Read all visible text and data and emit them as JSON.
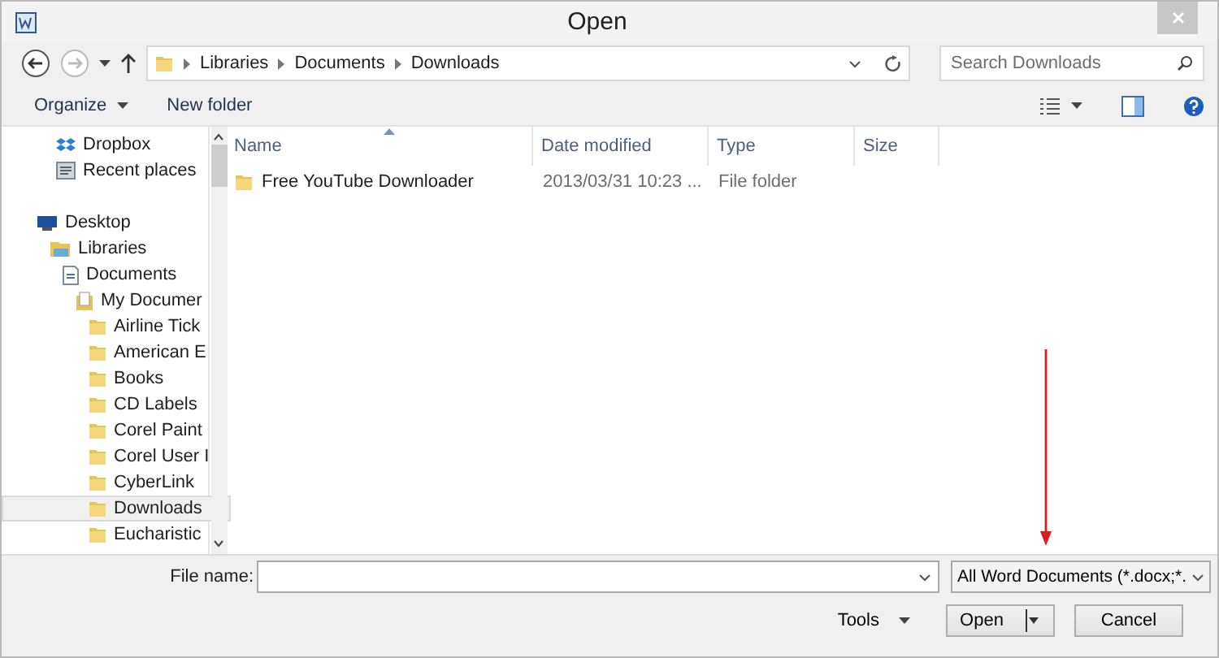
{
  "window": {
    "title": "Open"
  },
  "address_bar": {
    "path": [
      "Libraries",
      "Documents",
      "Downloads"
    ]
  },
  "search": {
    "placeholder": "Search Downloads"
  },
  "toolbar": {
    "buttons": [
      {
        "label": "Organize",
        "dropdown": true
      },
      {
        "label": "New folder",
        "dropdown": false
      }
    ]
  },
  "sidebar": {
    "favorites": [
      {
        "label": "Dropbox",
        "kind": "dropbox",
        "selected": false
      },
      {
        "label": "Recent places",
        "kind": "recent",
        "selected": false
      }
    ],
    "tree": [
      {
        "label": "Desktop",
        "kind": "desktop",
        "selected": false,
        "children": [
          {
            "label": "Libraries",
            "kind": "libraries",
            "selected": false,
            "children": [
              {
                "label": "Documents",
                "kind": "document",
                "selected": false,
                "children": [
                  {
                    "label": "My Documer",
                    "kind": "folder-doc",
                    "selected": false,
                    "children": [
                      {
                        "label": "Airline Tick",
                        "kind": "folder",
                        "selected": false
                      },
                      {
                        "label": "American E",
                        "kind": "folder",
                        "selected": false
                      },
                      {
                        "label": "Books",
                        "kind": "folder",
                        "selected": false
                      },
                      {
                        "label": "CD Labels",
                        "kind": "folder",
                        "selected": false
                      },
                      {
                        "label": "Corel Paint",
                        "kind": "folder",
                        "selected": false
                      },
                      {
                        "label": "Corel User I",
                        "kind": "folder",
                        "selected": false
                      },
                      {
                        "label": "CyberLink",
                        "kind": "folder",
                        "selected": false
                      },
                      {
                        "label": "Downloads",
                        "kind": "folder",
                        "selected": true
                      },
                      {
                        "label": "Eucharistic",
                        "kind": "folder",
                        "selected": false
                      }
                    ]
                  }
                ]
              }
            ]
          }
        ]
      }
    ]
  },
  "file_list": {
    "columns": [
      {
        "label": "Name",
        "sorted": true
      },
      {
        "label": "Date modified",
        "sorted": false
      },
      {
        "label": "Type",
        "sorted": false
      },
      {
        "label": "Size",
        "sorted": false
      }
    ],
    "rows": [
      {
        "name": "Free YouTube Downloader",
        "date_modified": "2013/03/31 10:23 ...",
        "type": "File folder"
      }
    ]
  },
  "footer": {
    "file_name_label": "File name:",
    "file_type": "All Word Documents (*.docx;*.",
    "tools": "Tools",
    "open": "Open",
    "cancel": "Cancel"
  }
}
